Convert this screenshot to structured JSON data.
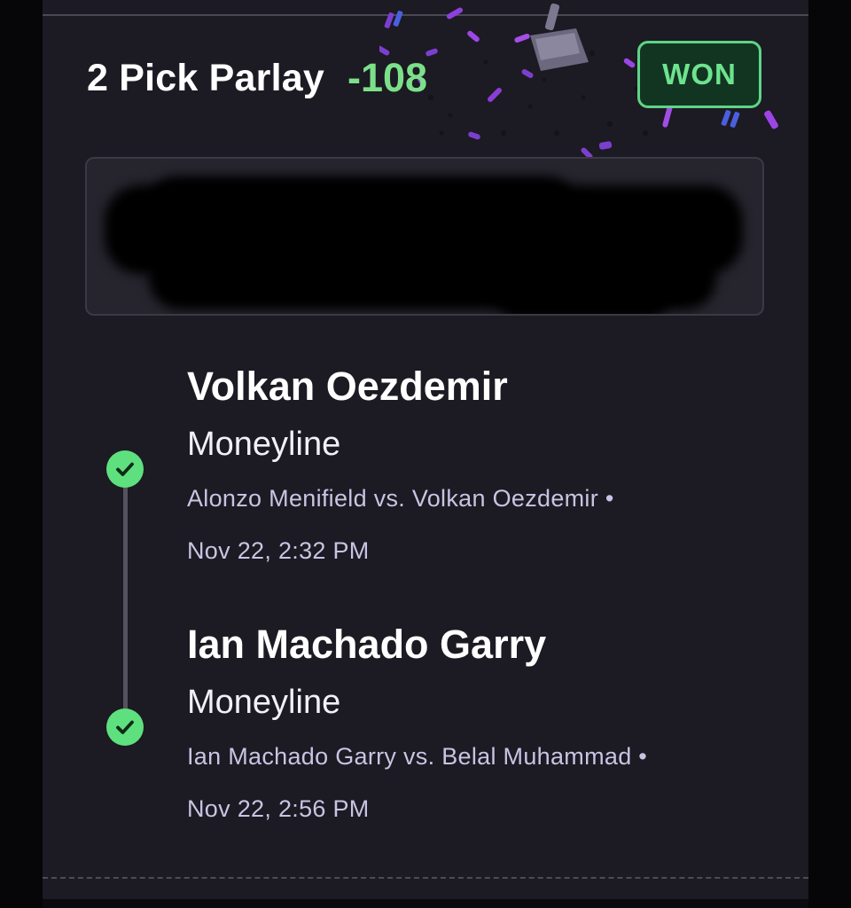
{
  "parlay": {
    "title": "2 Pick Parlay",
    "odds": "-108",
    "status": "WON"
  },
  "legs": [
    {
      "selection": "Volkan Oezdemir",
      "market": "Moneyline",
      "matchup": "Alonzo Menifield vs. Volkan Oezdemir •",
      "time": "Nov 22, 2:32 PM",
      "result_icon": "check-circle-icon"
    },
    {
      "selection": "Ian Machado Garry",
      "market": "Moneyline",
      "matchup": "Ian Machado Garry vs. Belal Muhammad •",
      "time": "Nov 22, 2:56 PM",
      "result_icon": "check-circle-icon"
    }
  ],
  "colors": {
    "background": "#1c1a22",
    "accent_green": "#7ce08a",
    "badge_bg": "#123522",
    "check_green": "#5ee07e",
    "secondary_text": "#c8c4e3"
  },
  "icons": {
    "celebration": "confetti-icon",
    "trophy": "trophy-icon"
  }
}
